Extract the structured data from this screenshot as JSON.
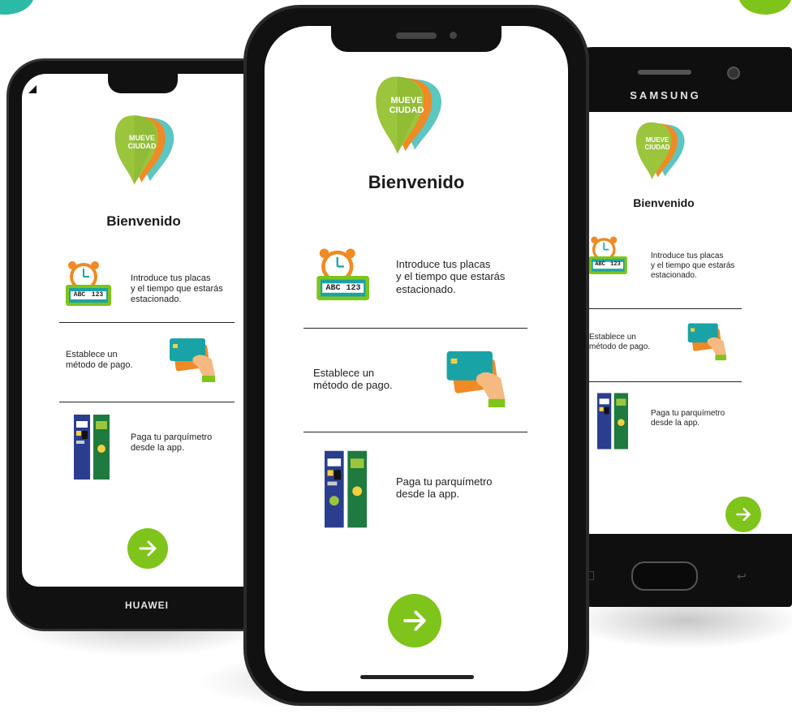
{
  "logo": {
    "line1": "MUEVE",
    "line2": "CIUDAD"
  },
  "screen": {
    "title": "Bienvenido",
    "step1": {
      "line1": "Introduce tus placas",
      "line2": "y el tiempo que estarás",
      "line3": "estacionado."
    },
    "step2": {
      "line1": "Establece un",
      "line2": "método de pago."
    },
    "step3": {
      "line1": "Paga tu parquímetro",
      "line2": "desde la app."
    },
    "plate": {
      "left": "ABC",
      "right": "123"
    }
  },
  "devices": {
    "left_brand": "HUAWEI",
    "right_brand": "SAMSUNG"
  },
  "colors": {
    "accent_green": "#7fc41a",
    "logo_lime": "#9bc53d",
    "logo_orange": "#f08a24",
    "logo_teal": "#5cc6c2",
    "card_teal": "#1aa3a6",
    "meter_blue": "#2a3d8f",
    "meter_green": "#1e7a3e"
  }
}
